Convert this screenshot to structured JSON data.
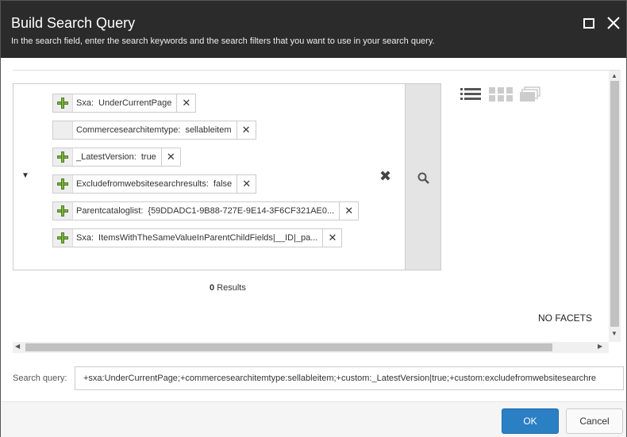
{
  "dialog": {
    "title": "Build Search Query",
    "subtitle": "In the search field, enter the search keywords and the search filters that you want to use in your search query."
  },
  "tokens": [
    {
      "key": "Sxa:",
      "value": "UnderCurrentPage",
      "icon": "plus-icon"
    },
    {
      "key": "Commercesearchitemtype:",
      "value": "sellableitem",
      "icon": "none"
    },
    {
      "key": "_LatestVersion:",
      "value": "true",
      "icon": "plus-icon"
    },
    {
      "key": "Excludefromwebsitesearchresults:",
      "value": "false",
      "icon": "plus-icon"
    },
    {
      "key": "Parentcataloglist:",
      "value": "{59DDADC1-9B88-727E-9E14-3F6CF321AE0...",
      "icon": "plus-icon"
    },
    {
      "key": "Sxa:",
      "value": "ItemsWithTheSameValueInParentChildFields|__ID|_pa...",
      "icon": "plus-icon"
    }
  ],
  "results": {
    "count": "0",
    "label": "Results"
  },
  "facets": {
    "empty_label": "NO FACETS"
  },
  "query": {
    "label": "Search query:",
    "value": "+sxa:UnderCurrentPage;+commercesearchitemtype:sellableitem;+custom:_LatestVersion|true;+custom:excludefromwebsitesearchre"
  },
  "buttons": {
    "ok": "OK",
    "cancel": "Cancel"
  },
  "colors": {
    "titlebar": "#2b2b2b",
    "primary": "#2b80c4",
    "plus": "#7cb342"
  }
}
